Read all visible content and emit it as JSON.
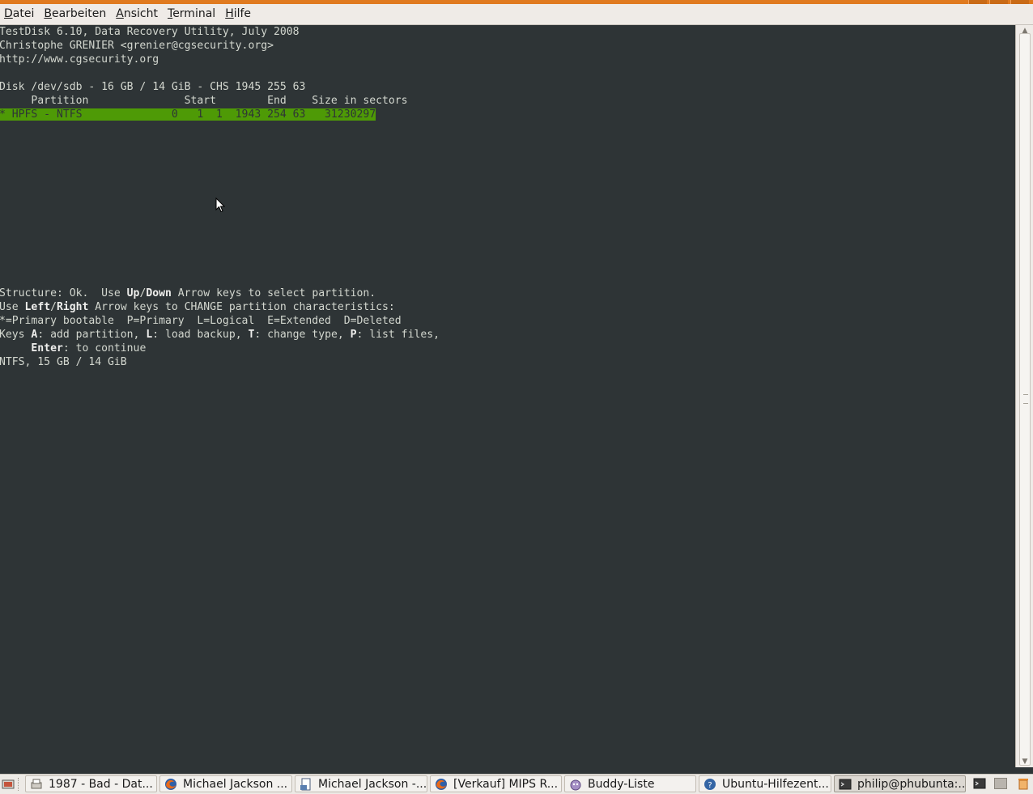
{
  "menu": [
    "Datei",
    "Bearbeiten",
    "Ansicht",
    "Terminal",
    "Hilfe"
  ],
  "menu_mnemonic": [
    "D",
    "B",
    "A",
    "T",
    "H"
  ],
  "terminal": {
    "header": [
      "TestDisk 6.10, Data Recovery Utility, July 2008",
      "Christophe GRENIER <grenier@cgsecurity.org>",
      "http://www.cgsecurity.org"
    ],
    "disk_line": "Disk /dev/sdb - 16 GB / 14 GiB - CHS 1945 255 63",
    "table_header": "     Partition               Start        End    Size in sectors",
    "partition_row": "* HPFS - NTFS              0   1  1  1943 254 63   31230297",
    "status_lines": [
      [
        {
          "t": "Structure: Ok.  Use "
        },
        {
          "t": "Up",
          "b": true
        },
        {
          "t": "/"
        },
        {
          "t": "Down",
          "b": true
        },
        {
          "t": " Arrow keys to select partition."
        }
      ],
      [
        {
          "t": "Use "
        },
        {
          "t": "Left",
          "b": true
        },
        {
          "t": "/"
        },
        {
          "t": "Right",
          "b": true
        },
        {
          "t": " Arrow keys to CHANGE partition characteristics:"
        }
      ],
      [
        {
          "t": "*=Primary bootable  P=Primary  L=Logical  E=Extended  D=Deleted"
        }
      ],
      [
        {
          "t": "Keys "
        },
        {
          "t": "A",
          "b": true
        },
        {
          "t": ": add partition, "
        },
        {
          "t": "L",
          "b": true
        },
        {
          "t": ": load backup, "
        },
        {
          "t": "T",
          "b": true
        },
        {
          "t": ": change type, "
        },
        {
          "t": "P",
          "b": true
        },
        {
          "t": ": list files,"
        }
      ],
      [
        {
          "t": "     "
        },
        {
          "t": "Enter",
          "b": true
        },
        {
          "t": ": to continue"
        }
      ],
      [
        {
          "t": "NTFS, 15 GB / 14 GiB"
        }
      ]
    ]
  },
  "taskbar": {
    "tasks": [
      {
        "label": "1987 - Bad - Dat...",
        "icon": "printer-document-icon"
      },
      {
        "label": "Michael Jackson ...",
        "icon": "firefox-icon"
      },
      {
        "label": "Michael Jackson -...",
        "icon": "document-viewer-icon"
      },
      {
        "label": "[Verkauf] MIPS R...",
        "icon": "firefox-icon"
      },
      {
        "label": "Buddy-Liste",
        "icon": "pidgin-icon"
      },
      {
        "label": "Ubuntu-Hilfezent...",
        "icon": "help-icon"
      },
      {
        "label": "philip@phubunta:...",
        "icon": "terminal-icon"
      }
    ]
  },
  "colors": {
    "terminal_bg": "#2e3436",
    "terminal_fg": "#d3d7cf",
    "highlight_bg": "#4e9a06",
    "title_accent": "#e07a1f"
  }
}
